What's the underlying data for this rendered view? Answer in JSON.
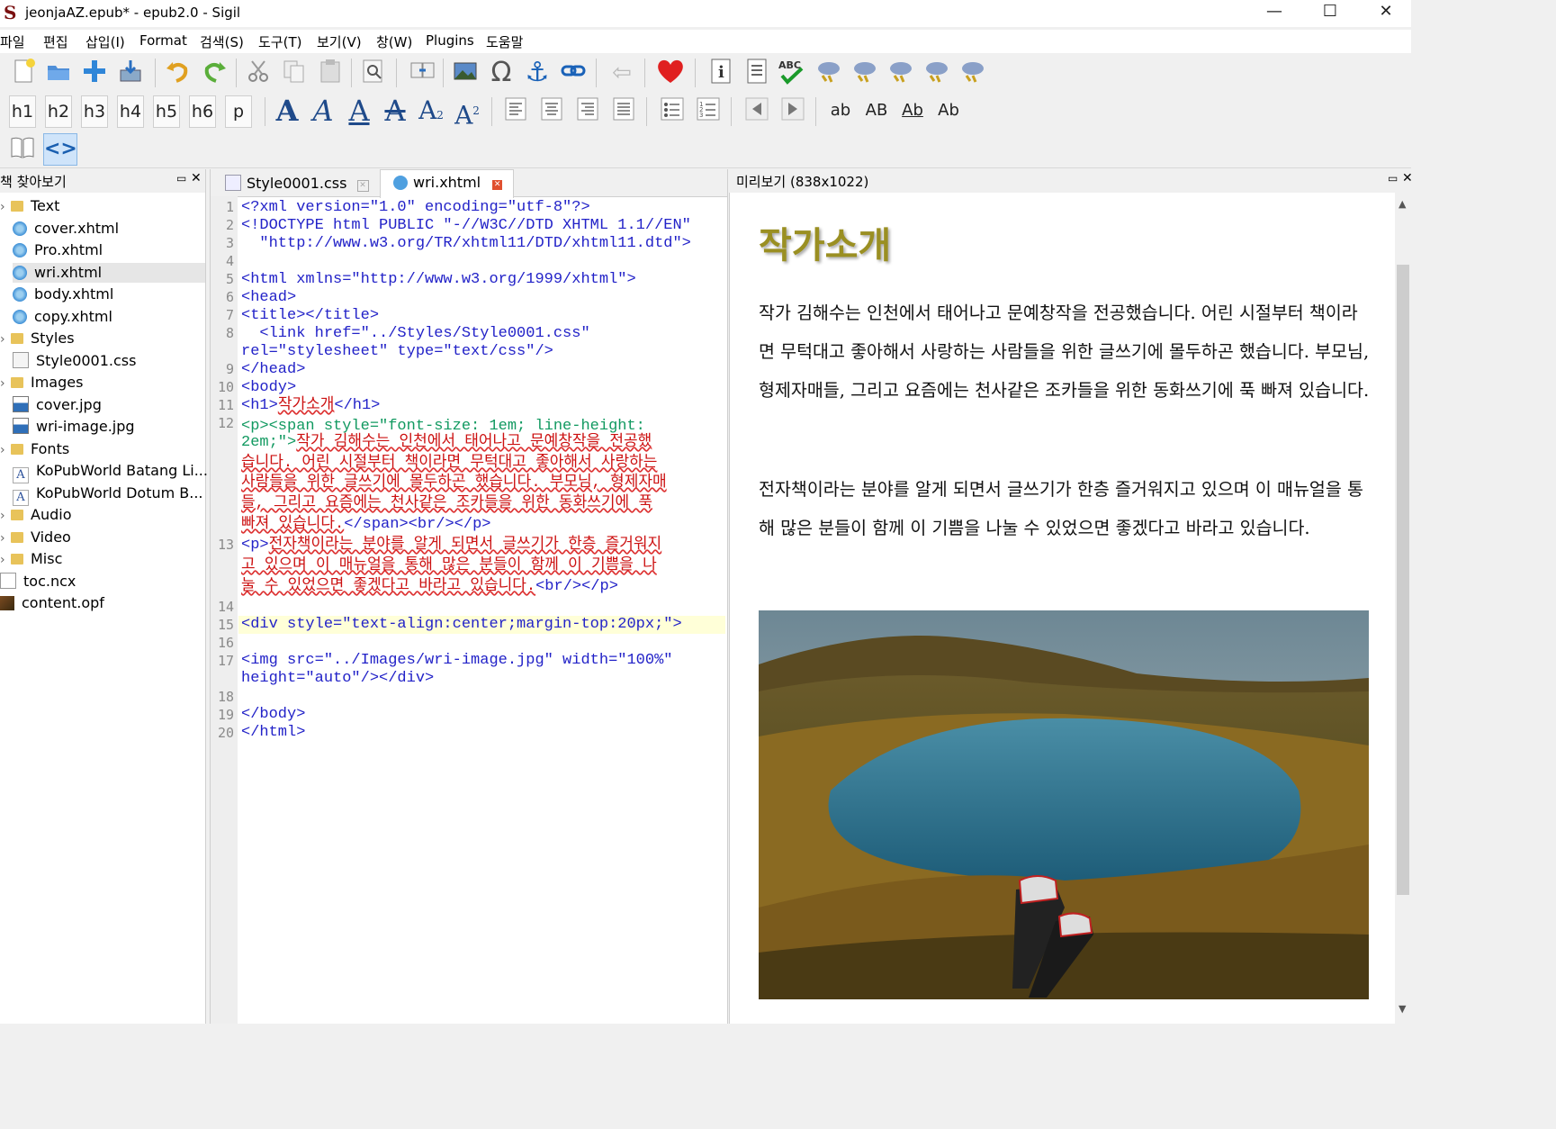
{
  "window": {
    "title": "jeonjaAZ.epub* - epub2.0 - Sigil",
    "minimize": "—",
    "maximize": "☐",
    "close": "✕"
  },
  "menu": [
    "파일",
    "편집",
    "삽입(I)",
    "Format",
    "검색(S)",
    "도구(T)",
    "보기(V)",
    "창(W)",
    "Plugins",
    "도움말"
  ],
  "heading_buttons": [
    "h1",
    "h2",
    "h3",
    "h4",
    "h5",
    "h6",
    "p"
  ],
  "case_buttons": [
    "ab",
    "AB",
    "Ab",
    "Ab"
  ],
  "toolbar_icons": [
    "new-file",
    "open-folder",
    "add-file",
    "save",
    "undo",
    "redo",
    "cut",
    "copy",
    "paste",
    "find-replace",
    "merge",
    "insert-image",
    "insert-special-character",
    "insert-anchor",
    "insert-link",
    "back",
    "donate-heart",
    "metadata-info",
    "table-of-contents",
    "spellcheck",
    "plugin-1",
    "plugin-2",
    "plugin-3",
    "plugin-4",
    "plugin-5"
  ],
  "book_browser": {
    "header": "책 찾아보기",
    "items": [
      {
        "label": "Text",
        "type": "folder"
      },
      {
        "label": "cover.xhtml",
        "type": "xhtml"
      },
      {
        "label": "Pro.xhtml",
        "type": "xhtml"
      },
      {
        "label": "wri.xhtml",
        "type": "xhtml",
        "selected": true
      },
      {
        "label": "body.xhtml",
        "type": "xhtml"
      },
      {
        "label": "copy.xhtml",
        "type": "xhtml"
      },
      {
        "label": "Styles",
        "type": "folder"
      },
      {
        "label": "Style0001.css",
        "type": "css"
      },
      {
        "label": "Images",
        "type": "folder"
      },
      {
        "label": "cover.jpg",
        "type": "image"
      },
      {
        "label": "wri-image.jpg",
        "type": "image"
      },
      {
        "label": "Fonts",
        "type": "folder"
      },
      {
        "label": "KoPubWorld Batang Li...",
        "type": "font"
      },
      {
        "label": "KoPubWorld Dotum B...",
        "type": "font"
      },
      {
        "label": "Audio",
        "type": "folder"
      },
      {
        "label": "Video",
        "type": "folder"
      },
      {
        "label": "Misc",
        "type": "folder"
      },
      {
        "label": "toc.ncx",
        "type": "ncx"
      },
      {
        "label": "content.opf",
        "type": "opf"
      }
    ]
  },
  "editor": {
    "tabs": [
      {
        "label": "Style0001.css",
        "active": false
      },
      {
        "label": "wri.xhtml",
        "active": true
      }
    ],
    "line_numbers": [
      "1",
      "2",
      "3",
      "4",
      "5",
      "6",
      "7",
      "8",
      "9",
      "10",
      "11",
      "12",
      "13",
      "14",
      "15",
      "16",
      "17",
      "18",
      "19",
      "20"
    ],
    "code": {
      "l1": "<?xml version=\"1.0\" encoding=\"utf-8\"?>",
      "l2": "<!DOCTYPE html PUBLIC \"-//W3C//DTD XHTML 1.1//EN\"",
      "l3": "  \"http://www.w3.org/TR/xhtml11/DTD/xhtml11.dtd\">",
      "l5": "<html xmlns=\"http://www.w3.org/1999/xhtml\">",
      "l6": "<head>",
      "l7": "<title></title>",
      "l8a": "  <link href=\"../Styles/Style0001.css\"",
      "l8b": "rel=\"stylesheet\" type=\"text/css\"/>",
      "l9": "</head>",
      "l10": "<body>",
      "l11_tag_open": "<h1>",
      "l11_text": "작가소개",
      "l11_tag_close": "</h1>",
      "l12a": "<p><span style=\"font-size: 1em; line-height:",
      "l12b_tag": "2em;\">",
      "l12b_text": "작가 김해수는 인천에서 태어나고 문예창작을 전공했",
      "l12c": "습니다. 어린 시절부터 책이라면 무턱대고 좋아해서 사랑하는",
      "l12d": "사람들을 위한 글쓰기에 몰두하곤 했습니다. 부모님, 형제자매",
      "l12e": "들, 그리고 요즘에는 천사같은 조카들을 위한 동화쓰기에 푹",
      "l12f_text": "빠져 있습니다.",
      "l12f_tag": "</span><br/></p>",
      "l13a_tag": "<p>",
      "l13a_text": "전자책이라는 분야를 알게 되면서 글쓰기가 한층 즐거워지",
      "l13b": "고 있으며 이 매뉴얼을 통해 많은 분들이 함께 이 기쁨을 나",
      "l13c_text": "눌 수 있었으면 좋겠다고 바라고 있습니다.",
      "l13c_tag": "<br/></p>",
      "l15": "<div style=\"text-align:center;margin-top:20px;\">",
      "l17a": "<img src=\"../Images/wri-image.jpg\" width=\"100%\"",
      "l17b": "height=\"auto\"/></div>",
      "l19": "</body>",
      "l20": "</html>"
    }
  },
  "preview": {
    "header": "미리보기 (838x1022)",
    "heading": "작가소개",
    "para1": "작가 김해수는 인천에서 태어나고 문예창작을 전공했습니다. 어린 시절부터 책이라면 무턱대고 좋아해서 사랑하는 사람들을 위한 글쓰기에 몰두하곤 했습니다. 부모님, 형제자매들, 그리고 요즘에는 천사같은 조카들을 위한 동화쓰기에 푹 빠져 있습니다.",
    "para2": "전자책이라는 분야를 알게 되면서 글쓰기가 한층 즐거워지고 있으며 이 매뉴얼을 통해 많은 분들이 함께 이 기쁨을 나눌 수 있었으면 좋겠다고 바라고 있습니다.",
    "image_icon": "landscape-lake-photo"
  },
  "colors": {
    "heading_olive": "#9a8f22",
    "tag_blue": "#2222c8",
    "value_green": "#119960",
    "korean_red": "#cc1111",
    "current_line": "#ffffd8"
  }
}
